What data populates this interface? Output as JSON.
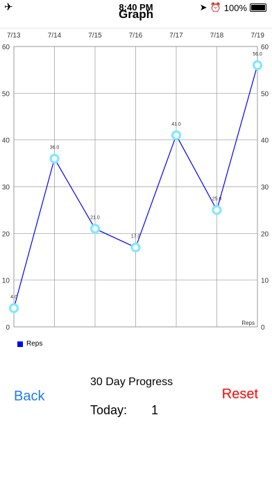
{
  "status_bar": {
    "time": "8:40 PM",
    "battery": "100%"
  },
  "nav": {
    "title": "Graph"
  },
  "chart_data": {
    "type": "line",
    "categories": [
      "7/13",
      "7/14",
      "7/15",
      "7/16",
      "7/17",
      "7/18",
      "7/19"
    ],
    "series": [
      {
        "name": "Reps",
        "values": [
          4,
          36,
          21,
          17,
          41,
          25,
          56
        ],
        "color": "#0000ff"
      }
    ],
    "data_labels": [
      "4.0",
      "36.0",
      "21.0",
      "17.0",
      "41.0",
      "25.0",
      "56.0"
    ],
    "yticks": [
      0,
      10,
      20,
      30,
      40,
      50,
      60
    ],
    "ylim": [
      0,
      60
    ],
    "axis_label": "Reps",
    "grid": true,
    "marker_color": "#7fe8ff",
    "legend_position": "bottom-left"
  },
  "progress": {
    "title": "30 Day Progress",
    "today_label": "Today:",
    "today_value": "1"
  },
  "buttons": {
    "back": "Back",
    "reset": "Reset"
  },
  "colors": {
    "back": "#1a7cf0",
    "reset": "#ff0000"
  }
}
